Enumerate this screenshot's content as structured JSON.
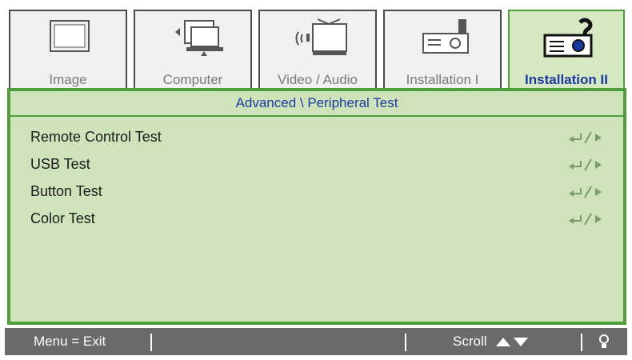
{
  "tabs": [
    {
      "label": "Image",
      "icon": "monitor-icon",
      "active": false
    },
    {
      "label": "Computer",
      "icon": "computer-icon",
      "active": false
    },
    {
      "label": "Video / Audio",
      "icon": "video-audio-icon",
      "active": false
    },
    {
      "label": "Installation I",
      "icon": "projector-icon",
      "active": false
    },
    {
      "label": "Installation II",
      "icon": "projector-help-icon",
      "active": true
    }
  ],
  "panel": {
    "title": "Advanced \\ Peripheral Test",
    "items": [
      {
        "label": "Remote Control Test",
        "action_icon": "enter-right-icon"
      },
      {
        "label": "USB Test",
        "action_icon": "enter-right-icon"
      },
      {
        "label": "Button Test",
        "action_icon": "enter-right-icon"
      },
      {
        "label": "Color Test",
        "action_icon": "enter-right-icon"
      }
    ]
  },
  "status": {
    "menu_exit": "Menu = Exit",
    "scroll": "Scroll",
    "scroll_icon": "up-down-arrows-icon",
    "power_icon": "bulb-icon"
  },
  "colors": {
    "accent_green": "#4e9e3c",
    "panel_bg": "#cfe3bb",
    "title_blue": "#1a3aa0",
    "status_gray": "#6a6a6a"
  }
}
